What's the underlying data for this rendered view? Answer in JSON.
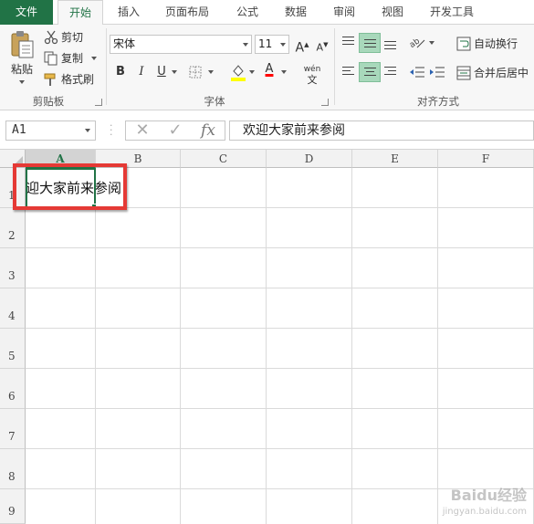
{
  "ribbon_tabs": [
    "文件",
    "开始",
    "插入",
    "页面布局",
    "公式",
    "数据",
    "审阅",
    "视图",
    "开发工具"
  ],
  "active_tab": "开始",
  "clipboard": {
    "paste_label": "粘贴",
    "cut_label": "剪切",
    "copy_label": "复制",
    "format_painter_label": "格式刷",
    "group_label": "剪贴板"
  },
  "font": {
    "font_name": "宋体",
    "font_size": "11",
    "bold": "B",
    "italic": "I",
    "underline": "U",
    "font_color_letter": "A",
    "phonetic": "wén",
    "group_label": "字体"
  },
  "alignment": {
    "wrap_text_label": "自动换行",
    "merge_center_label": "合并后居中",
    "group_label": "对齐方式"
  },
  "formula_bar": {
    "name_box": "A1",
    "fx": "fx",
    "content": "欢迎大家前来参阅"
  },
  "columns": [
    "A",
    "B",
    "C",
    "D",
    "E",
    "F"
  ],
  "rows": [
    "1",
    "2",
    "3",
    "4",
    "5",
    "6",
    "7",
    "8",
    "9"
  ],
  "selected_cell": "A1",
  "cell_a1_visible_text": "迎大家前来参阅",
  "watermark": {
    "line1": "Baidu经验",
    "line2": "jingyan.baidu.com"
  },
  "colors": {
    "excel_green": "#217346",
    "highlight_border": "#e53935"
  }
}
